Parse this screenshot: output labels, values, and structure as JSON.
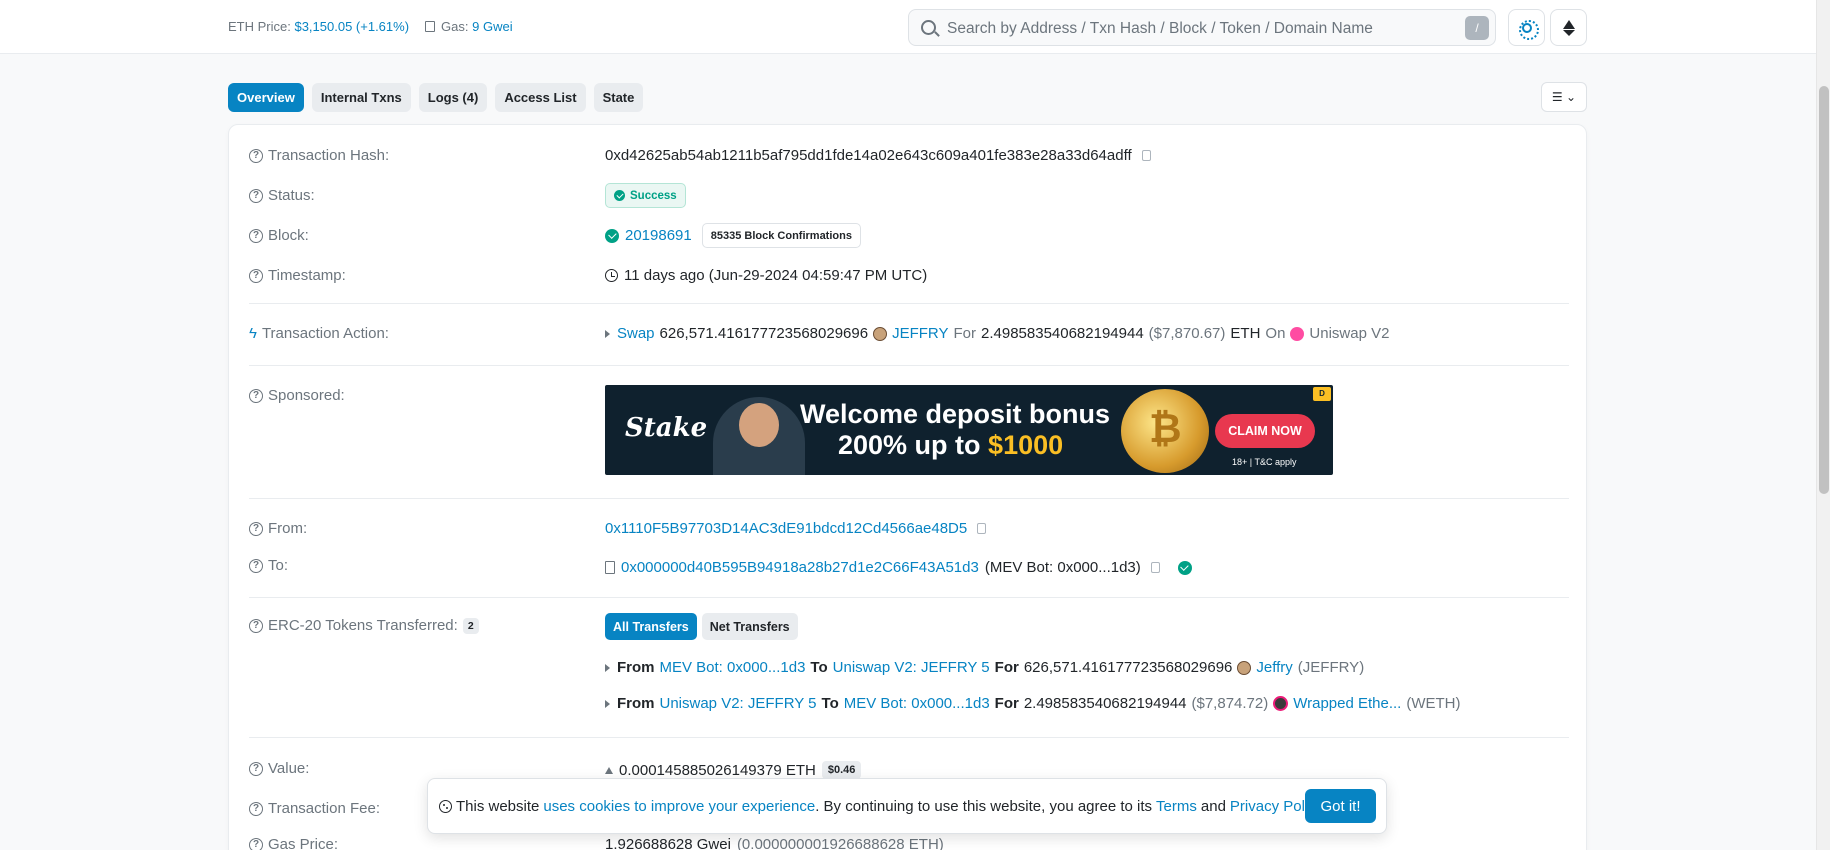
{
  "header": {
    "eth_price_label": "ETH Price:",
    "eth_price_value": "$3,150.05 (+1.61%)",
    "gas_label": "Gas:",
    "gas_value": "9 Gwei",
    "search_placeholder": "Search by Address / Txn Hash / Block / Token / Domain Name",
    "search_shortcut": "/"
  },
  "tabs": [
    "Overview",
    "Internal Txns",
    "Logs (4)",
    "Access List",
    "State"
  ],
  "overview": {
    "tx_hash": {
      "label": "Transaction Hash:",
      "value": "0xd42625ab54ab1211b5af795dd1fde14a02e643c609a401fe383e28a33d64adff"
    },
    "status": {
      "label": "Status:",
      "value": "Success"
    },
    "block": {
      "label": "Block:",
      "number": "20198691",
      "confirmations": "85335 Block Confirmations"
    },
    "timestamp": {
      "label": "Timestamp:",
      "value": "11 days ago (Jun-29-2024 04:59:47 PM UTC)"
    },
    "action": {
      "label": "Transaction Action:",
      "verb": "Swap",
      "amount1": "626,571.416177723568029696",
      "token1": "JEFFRY",
      "for": "For",
      "amount2": "2.498583540682194944",
      "usd": "($7,870.67)",
      "token2": "ETH",
      "on": "On",
      "dex": "Uniswap V2"
    },
    "sponsored": {
      "label": "Sponsored:",
      "brand": "Stake",
      "headline1": "Welcome deposit bonus",
      "headline2_prefix": "200% up to",
      "headline2_amount": "$1000",
      "coin": "₿",
      "cta": "CLAIM NOW",
      "terms": "18+ | T&C apply",
      "adchoice": "D"
    },
    "from": {
      "label": "From:",
      "value": "0x1110F5B97703D14AC3dE91bdcd12Cd4566ae48D5"
    },
    "to": {
      "label": "To:",
      "value": "0x000000d40B595B94918a28b27d1e2C66F43A51d3",
      "name": "(MEV Bot: 0x000...1d3)"
    },
    "erc20": {
      "label": "ERC-20 Tokens Transferred:",
      "count": "2",
      "btn_all": "All Transfers",
      "btn_net": "Net Transfers",
      "transfers": [
        {
          "from_kw": "From",
          "from": "MEV Bot: 0x000...1d3",
          "to_kw": "To",
          "to": "Uniswap V2: JEFFRY 5",
          "for_kw": "For",
          "amount": "626,571.416177723568029696",
          "usd": "",
          "token": "Jeffry",
          "symbol": "(JEFFRY)"
        },
        {
          "from_kw": "From",
          "from": "Uniswap V2: JEFFRY 5",
          "to_kw": "To",
          "to": "MEV Bot: 0x000...1d3",
          "for_kw": "For",
          "amount": "2.498583540682194944",
          "usd": "($7,874.72)",
          "token": "Wrapped Ethe...",
          "symbol": "(WETH)"
        }
      ]
    },
    "value": {
      "label": "Value:",
      "amount": "0.000145885026149379 ETH",
      "usd": "$0.46"
    },
    "fee": {
      "label": "Transaction Fee:"
    },
    "gas_price": {
      "label": "Gas Price:",
      "value": "1.926688628 Gwei",
      "eth": "(0.000000001926688628 ETH)"
    }
  },
  "cookie": {
    "prefix": "This website",
    "link1": "uses cookies to improve your experience",
    "middle": ". By continuing to use this website, you agree to its",
    "terms": "Terms",
    "and": "and",
    "privacy": "Privacy Policy",
    "end": ".",
    "button": "Got it!"
  },
  "colors": {
    "accent": "#0784c3",
    "success": "#00a186"
  }
}
